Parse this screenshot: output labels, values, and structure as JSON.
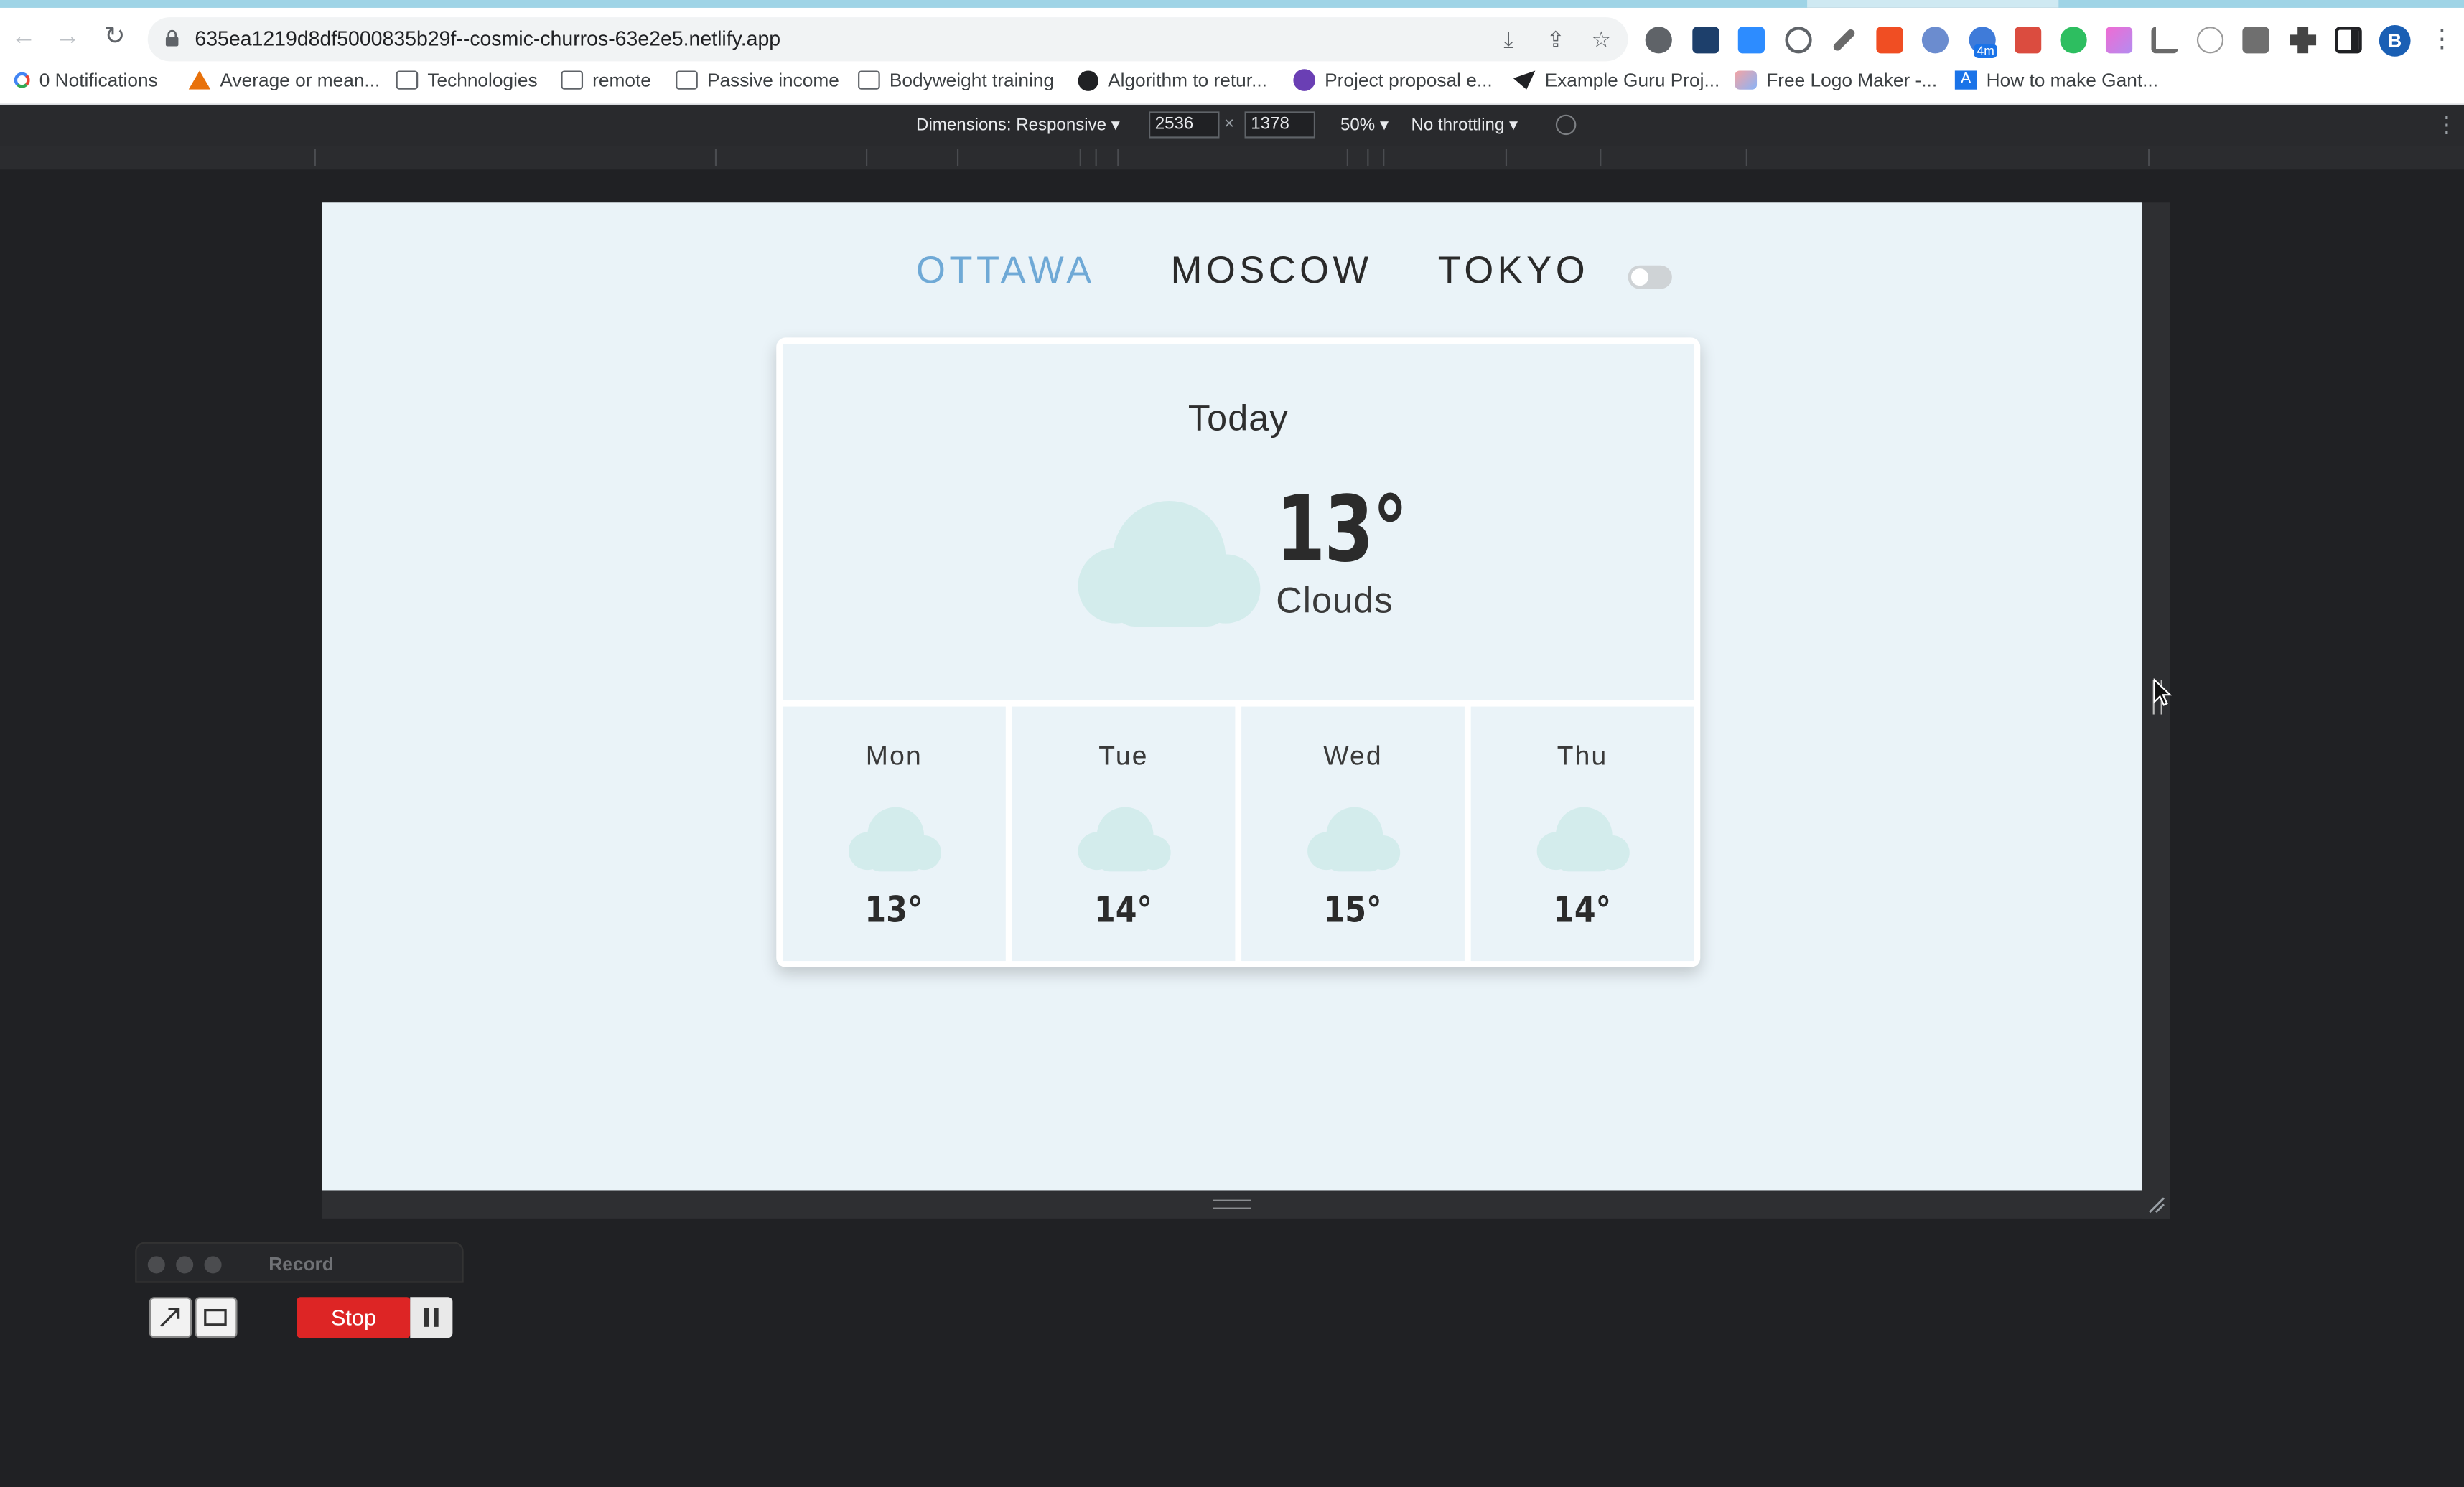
{
  "browser": {
    "url": "635ea1219d8df5000835b29f--cosmic-churros-63e2e5.netlify.app",
    "profile_initial": "B",
    "extension_badge": "4m",
    "bookmarks": [
      "0 Notifications",
      "Average or mean...",
      "Technologies",
      "remote",
      "Passive income",
      "Bodyweight training",
      "Algorithm to retur...",
      "Project proposal e...",
      "Example Guru Proj...",
      "Free Logo Maker -...",
      "How to make Gant..."
    ]
  },
  "devtools": {
    "dimensions_label": "Dimensions: Responsive",
    "width": "2536",
    "height": "1378",
    "times": "×",
    "zoom": "50%",
    "throttling": "No throttling"
  },
  "app": {
    "cities": [
      "OTTAWA",
      "MOSCOW",
      "TOKYO"
    ],
    "active_city": "OTTAWA",
    "theme_toggle_on": false,
    "today": {
      "label": "Today",
      "temp": "13°",
      "description": "Clouds",
      "icon": "cloud-icon"
    },
    "forecast": [
      {
        "day": "Mon",
        "temp": "13°",
        "icon": "cloud-icon"
      },
      {
        "day": "Tue",
        "temp": "14°",
        "icon": "cloud-icon"
      },
      {
        "day": "Wed",
        "temp": "15°",
        "icon": "cloud-icon"
      },
      {
        "day": "Thu",
        "temp": "14°",
        "icon": "cloud-icon"
      }
    ],
    "colors": {
      "active_city": "#6fa9d6",
      "cloud": "#d3ecec",
      "panel_bg": "#eaf3f8"
    }
  },
  "recorder": {
    "title": "Record",
    "stop_label": "Stop"
  }
}
